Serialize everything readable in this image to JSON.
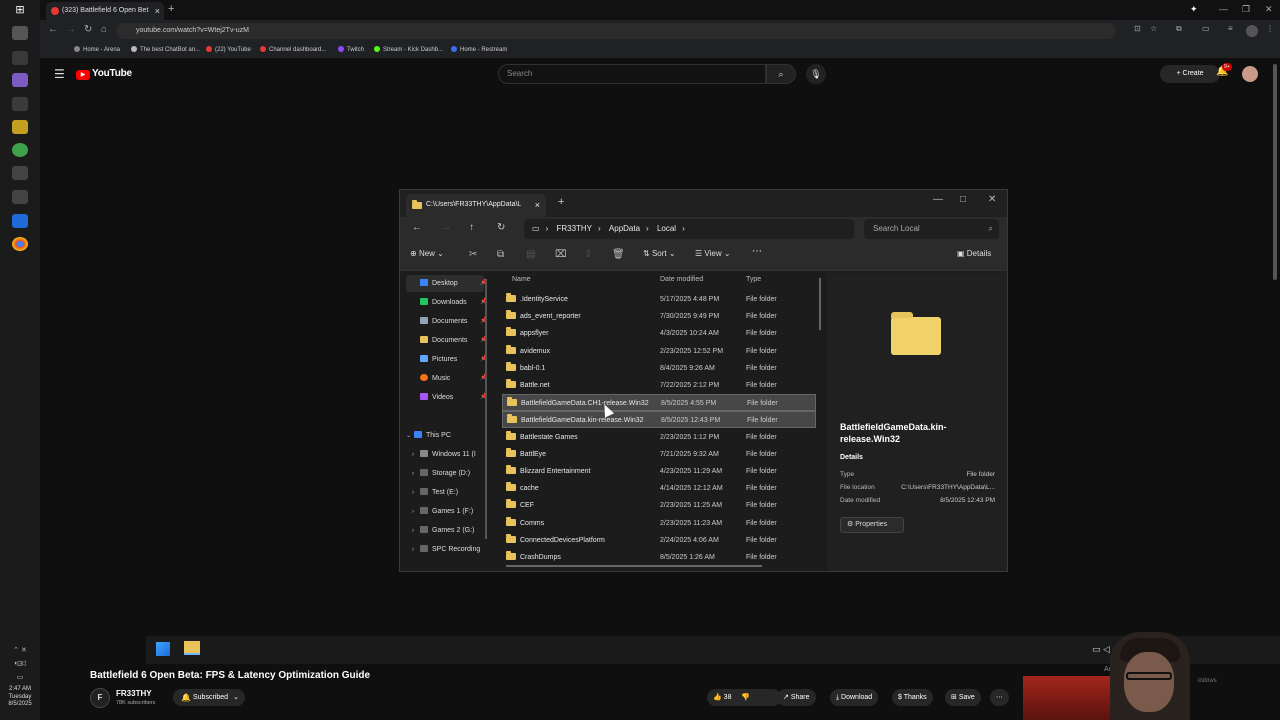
{
  "browser": {
    "tab_title": "(323) Battlefield 6 Open Bet",
    "url": "youtube.com/watch?v=Wtej2Tv-uzM",
    "bookmarks": [
      {
        "label": "Home - Arena",
        "color": "#888888"
      },
      {
        "label": "The best ChatBot an...",
        "color": "#bbbbbb"
      },
      {
        "label": "(22) YouTube",
        "color": "#e53935"
      },
      {
        "label": "Channel dashboard...",
        "color": "#e53935"
      },
      {
        "label": "Twitch",
        "color": "#9146ff"
      },
      {
        "label": "Stream - Kick Dashb...",
        "color": "#53fc18"
      },
      {
        "label": "Home - Restream",
        "color": "#3a6df0"
      }
    ]
  },
  "youtube": {
    "logo": "YouTube",
    "search_placeholder": "Search",
    "create_label": "Create",
    "notif_badge": "9+",
    "video_title": "Battlefield 6 Open Beta: FPS & Latency Optimization Guide",
    "channel_name": "FR33THY",
    "channel_avatar": "F",
    "subscribers": "78K subscribers",
    "subscribed_label": "Subscribed",
    "likes": "38",
    "share_label": "Share",
    "download_label": "Download",
    "thanks_label": "Thanks",
    "save_label": "Save"
  },
  "explorer": {
    "tab_title": "C:\\Users\\FR33THY\\AppData\\L",
    "breadcrumb": [
      "FR33THY",
      "AppData",
      "Local"
    ],
    "search_placeholder": "Search Local",
    "toolbar": {
      "new": "New",
      "sort": "Sort",
      "view": "View",
      "details": "Details"
    },
    "nav": {
      "quick": [
        {
          "label": "Desktop",
          "color": "#3b82f6"
        },
        {
          "label": "Downloads",
          "color": "#22c55e"
        },
        {
          "label": "Documents",
          "color": "#94a3b8"
        },
        {
          "label": "Documents",
          "color": "#e8c35b"
        },
        {
          "label": "Pictures",
          "color": "#60a5fa"
        },
        {
          "label": "Music",
          "color": "#f97316"
        },
        {
          "label": "Videos",
          "color": "#a855f7"
        }
      ],
      "this_pc": "This PC",
      "drives": [
        "Windows 11 (I",
        "Storage (D:)",
        "Test (E:)",
        "Games 1 (F:)",
        "Games 2 (G:)",
        "SPC Recording"
      ]
    },
    "columns": {
      "name": "Name",
      "date": "Date modified",
      "type": "Type"
    },
    "rows": [
      {
        "name": ".IdentityService",
        "date": "5/17/2025 4:48 PM",
        "type": "File folder"
      },
      {
        "name": "ads_event_reporter",
        "date": "7/30/2025 9:49 PM",
        "type": "File folder"
      },
      {
        "name": "appsflyer",
        "date": "4/3/2025 10:24 AM",
        "type": "File folder"
      },
      {
        "name": "avidemux",
        "date": "2/23/2025 12:52 PM",
        "type": "File folder"
      },
      {
        "name": "babl-0.1",
        "date": "8/4/2025 9:26 AM",
        "type": "File folder"
      },
      {
        "name": "Battle.net",
        "date": "7/22/2025 2:12 PM",
        "type": "File folder"
      },
      {
        "name": "BattlefieldGameData.CH1-release.Win32",
        "date": "8/5/2025 4:55 PM",
        "type": "File folder"
      },
      {
        "name": "BattlefieldGameData.kin-release.Win32",
        "date": "8/5/2025 12:43 PM",
        "type": "File folder"
      },
      {
        "name": "Battlestate Games",
        "date": "2/23/2025 1:12 PM",
        "type": "File folder"
      },
      {
        "name": "BattlEye",
        "date": "7/21/2025 9:32 AM",
        "type": "File folder"
      },
      {
        "name": "Blizzard Entertainment",
        "date": "4/23/2025 11:29 AM",
        "type": "File folder"
      },
      {
        "name": "cache",
        "date": "4/14/2025 12:12 AM",
        "type": "File folder"
      },
      {
        "name": "CEF",
        "date": "2/23/2025 11:25 AM",
        "type": "File folder"
      },
      {
        "name": "Comms",
        "date": "2/23/2025 11:23 AM",
        "type": "File folder"
      },
      {
        "name": "ConnectedDevicesPlatform",
        "date": "2/24/2025 4:06 AM",
        "type": "File folder"
      },
      {
        "name": "CrashDumps",
        "date": "8/5/2025 1:26 AM",
        "type": "File folder"
      }
    ],
    "details": {
      "name": "BattlefieldGameData.kin-release.Win32",
      "section": "Details",
      "type_label": "Type",
      "type_value": "File folder",
      "location_label": "File location",
      "location_value": "C:\\Users\\FR33THY\\AppData\\L...",
      "date_label": "Date modified",
      "date_value": "8/5/2025 12:43 PM",
      "properties": "Properties"
    }
  },
  "overlay": {
    "activate": "Act",
    "windows": "indows"
  },
  "system": {
    "time": "2:47 AM",
    "day": "Tuesday",
    "date": "8/5/2025"
  }
}
